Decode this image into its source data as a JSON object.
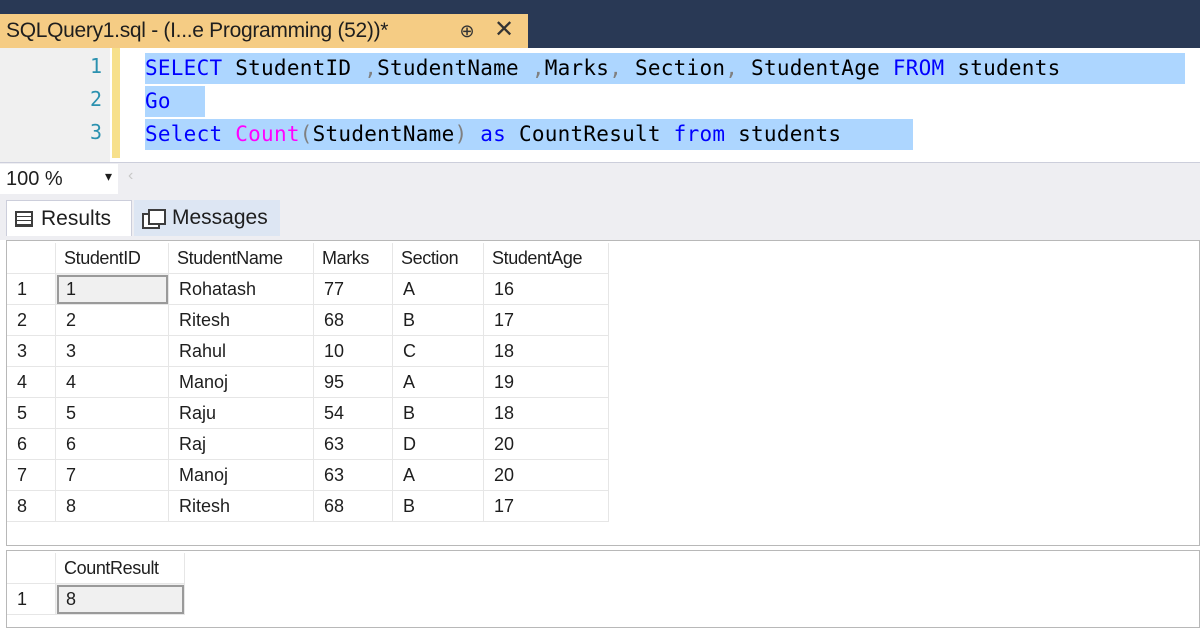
{
  "tab": {
    "title": "SQLQuery1.sql - (I...e Programming (52))*",
    "pin_glyph": "⊕",
    "close_glyph": "✕"
  },
  "editor": {
    "line_numbers": [
      "1",
      "2",
      "3"
    ],
    "lines": [
      [
        {
          "t": "SELECT",
          "c": "kw"
        },
        {
          "t": " StudentID ",
          "c": "tx"
        },
        {
          "t": ",",
          "c": "gr"
        },
        {
          "t": "StudentName ",
          "c": "tx"
        },
        {
          "t": ",",
          "c": "gr"
        },
        {
          "t": "Marks",
          "c": "tx"
        },
        {
          "t": ",",
          "c": "gr"
        },
        {
          "t": " Section",
          "c": "tx"
        },
        {
          "t": ",",
          "c": "gr"
        },
        {
          "t": " StudentAge ",
          "c": "tx"
        },
        {
          "t": "FROM",
          "c": "kw"
        },
        {
          "t": " students ",
          "c": "tx"
        }
      ],
      [
        {
          "t": "Go",
          "c": "kw"
        },
        {
          "t": " ",
          "c": "tx"
        }
      ],
      [
        {
          "t": "Select ",
          "c": "kw"
        },
        {
          "t": "Count",
          "c": "fn"
        },
        {
          "t": "(",
          "c": "gr"
        },
        {
          "t": "StudentName",
          "c": "tx"
        },
        {
          "t": ")",
          "c": "gr"
        },
        {
          "t": " as ",
          "c": "kw"
        },
        {
          "t": "CountResult ",
          "c": "tx"
        },
        {
          "t": "from",
          "c": "kw"
        },
        {
          "t": " students",
          "c": "tx"
        }
      ]
    ]
  },
  "zoom": {
    "value": "100 %",
    "arrow": "▾",
    "scroll_glyph": "‹"
  },
  "result_tabs": {
    "results": "Results",
    "messages": "Messages"
  },
  "grid1": {
    "columns": [
      "StudentID",
      "StudentName",
      "Marks",
      "Section",
      "StudentAge"
    ],
    "rows": [
      [
        "1",
        "1",
        "Rohatash",
        "77",
        "A",
        "16"
      ],
      [
        "2",
        "2",
        "Ritesh",
        "68",
        "B",
        "17"
      ],
      [
        "3",
        "3",
        "Rahul",
        "10",
        "C",
        "18"
      ],
      [
        "4",
        "4",
        "Manoj",
        "95",
        "A",
        "19"
      ],
      [
        "5",
        "5",
        "Raju",
        "54",
        "B",
        "18"
      ],
      [
        "6",
        "6",
        "Raj",
        "63",
        "D",
        "20"
      ],
      [
        "7",
        "7",
        "Manoj",
        "63",
        "A",
        "20"
      ],
      [
        "8",
        "8",
        "Ritesh",
        "68",
        "B",
        "17"
      ]
    ]
  },
  "grid2": {
    "columns": [
      "CountResult"
    ],
    "rows": [
      [
        "1",
        "8"
      ]
    ]
  }
}
